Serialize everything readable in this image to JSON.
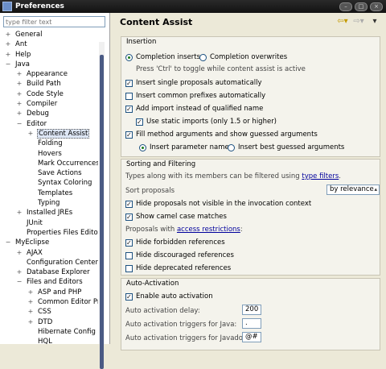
{
  "window": {
    "title": "Preferences"
  },
  "filter": {
    "placeholder": "type filter text"
  },
  "tree": [
    {
      "label": "General",
      "level": 0,
      "toggle": "+"
    },
    {
      "label": "Ant",
      "level": 0,
      "toggle": "+"
    },
    {
      "label": "Help",
      "level": 0,
      "toggle": "+"
    },
    {
      "label": "Java",
      "level": 0,
      "toggle": "−"
    },
    {
      "label": "Appearance",
      "level": 1,
      "toggle": "+"
    },
    {
      "label": "Build Path",
      "level": 1,
      "toggle": "+"
    },
    {
      "label": "Code Style",
      "level": 1,
      "toggle": "+"
    },
    {
      "label": "Compiler",
      "level": 1,
      "toggle": "+"
    },
    {
      "label": "Debug",
      "level": 1,
      "toggle": "+"
    },
    {
      "label": "Editor",
      "level": 1,
      "toggle": "−"
    },
    {
      "label": "Content Assist",
      "level": 2,
      "toggle": "+",
      "selected": true
    },
    {
      "label": "Folding",
      "level": 2,
      "toggle": ""
    },
    {
      "label": "Hovers",
      "level": 2,
      "toggle": ""
    },
    {
      "label": "Mark Occurrences",
      "level": 2,
      "toggle": ""
    },
    {
      "label": "Save Actions",
      "level": 2,
      "toggle": ""
    },
    {
      "label": "Syntax Coloring",
      "level": 2,
      "toggle": ""
    },
    {
      "label": "Templates",
      "level": 2,
      "toggle": ""
    },
    {
      "label": "Typing",
      "level": 2,
      "toggle": ""
    },
    {
      "label": "Installed JREs",
      "level": 1,
      "toggle": "+"
    },
    {
      "label": "JUnit",
      "level": 1,
      "toggle": ""
    },
    {
      "label": "Properties Files Editor",
      "level": 1,
      "toggle": ""
    },
    {
      "label": "MyEclipse",
      "level": 0,
      "toggle": "−"
    },
    {
      "label": "AJAX",
      "level": 1,
      "toggle": "+"
    },
    {
      "label": "Configuration Center",
      "level": 1,
      "toggle": ""
    },
    {
      "label": "Database Explorer",
      "level": 1,
      "toggle": "+"
    },
    {
      "label": "Files and Editors",
      "level": 1,
      "toggle": "−"
    },
    {
      "label": "ASP and PHP",
      "level": 2,
      "toggle": "+"
    },
    {
      "label": "Common Editor Pre",
      "level": 2,
      "toggle": "+"
    },
    {
      "label": "CSS",
      "level": 2,
      "toggle": "+"
    },
    {
      "label": "DTD",
      "level": 2,
      "toggle": "+"
    },
    {
      "label": "Hibernate Config",
      "level": 2,
      "toggle": ""
    },
    {
      "label": "HQL",
      "level": 2,
      "toggle": ""
    }
  ],
  "page": {
    "title": "Content Assist"
  },
  "insertion": {
    "title": "Insertion",
    "completion_inserts": "Completion inserts",
    "completion_overwrites": "Completion overwrites",
    "toggle_hint": "Press 'Ctrl' to toggle while content assist is active",
    "insert_single": "Insert single proposals automatically",
    "insert_common": "Insert common prefixes automatically",
    "add_import": "Add import instead of qualified name",
    "use_static": "Use static imports (only 1.5 or higher)",
    "fill_args": "Fill method arguments and show guessed arguments",
    "insert_param_names": "Insert parameter names",
    "insert_best_guessed": "Insert best guessed arguments"
  },
  "sorting": {
    "title": "Sorting and Filtering",
    "types_text": "Types along with its members can be filtered using",
    "type_filters_link": "type filters",
    "sort_label": "Sort proposals",
    "sort_value": "by relevance",
    "hide_invisible": "Hide proposals not visible in the invocation context",
    "show_camel": "Show camel case matches",
    "proposals_with": "Proposals with",
    "access_link": "access restrictions",
    "hide_forbidden": "Hide forbidden references",
    "hide_discouraged": "Hide discouraged references",
    "hide_deprecated": "Hide deprecated references"
  },
  "auto": {
    "title": "Auto-Activation",
    "enable": "Enable auto activation",
    "delay_label": "Auto activation delay:",
    "delay_value": "200",
    "java_label": "Auto activation triggers for Java:",
    "java_value": ".",
    "javadoc_label": "Auto activation triggers for Javadoc:",
    "javadoc_value": "@#"
  }
}
